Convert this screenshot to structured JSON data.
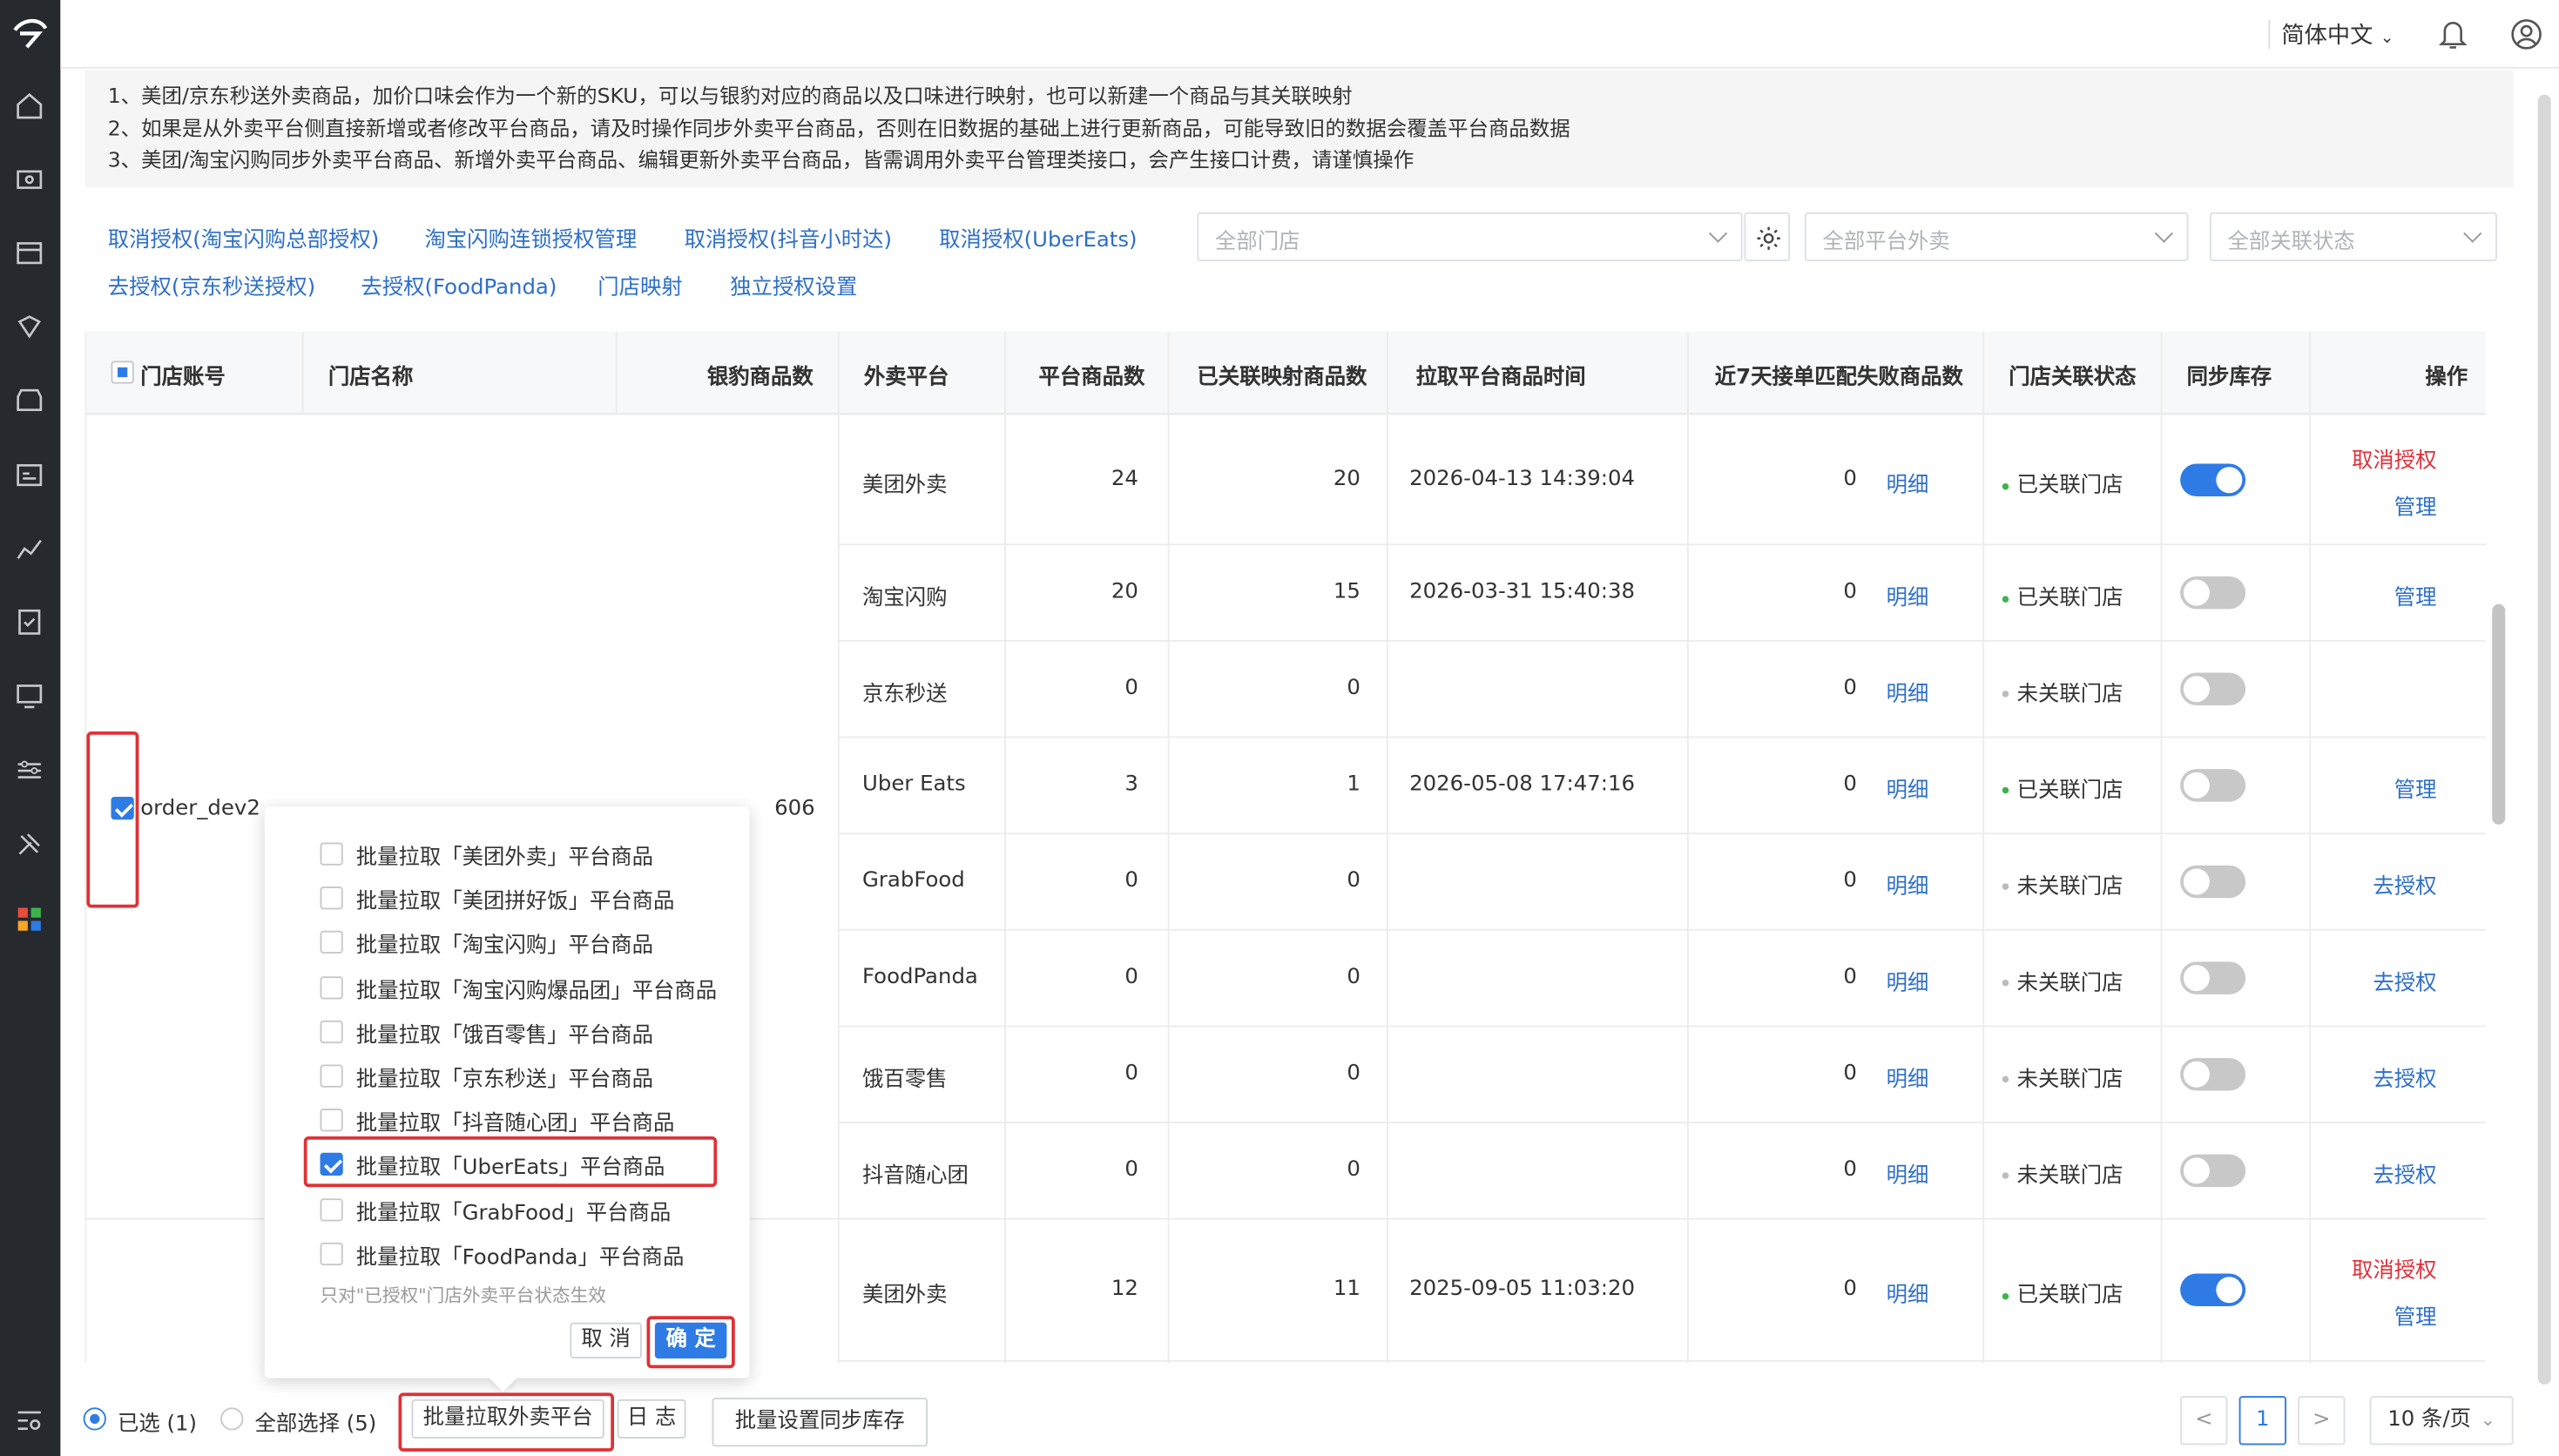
{
  "topbar": {
    "language": "简体中文"
  },
  "notice": [
    "1、美团/京东秒送外卖商品，加价口味会作为一个新的SKU，可以与银豹对应的商品以及口味进行映射，也可以新建一个商品与其关联映射",
    "2、如果是从外卖平台侧直接新增或者修改平台商品，请及时操作同步外卖平台商品，否则在旧数据的基础上进行更新商品，可能导致旧的数据会覆盖平台商品数据",
    "3、美团/淘宝闪购同步外卖平台商品、新增外卖平台商品、编辑更新外卖平台商品，皆需调用外卖平台管理类接口，会产生接口计费，请谨慎操作"
  ],
  "links": [
    "取消授权(淘宝闪购总部授权)",
    "淘宝闪购连锁授权管理",
    "取消授权(抖音小时达)",
    "取消授权(UberEats)",
    "去授权(京东秒送授权)",
    "去授权(FoodPanda)",
    "门店映射",
    "独立授权设置"
  ],
  "filters": {
    "store": "全部门店",
    "platform": "全部平台外卖",
    "status": "全部关联状态"
  },
  "columns": [
    "门店账号",
    "门店名称",
    "银豹商品数",
    "外卖平台",
    "平台商品数",
    "已关联映射商品数",
    "拉取平台商品时间",
    "近7天接单匹配失败商品数",
    "门店关联状态",
    "同步库存",
    "操作"
  ],
  "group1": {
    "account": "order_dev2",
    "name": "...",
    "product_count": "606"
  },
  "rows": [
    {
      "platform": "美团外卖",
      "platform_count": "24",
      "mapped": "20",
      "time": "2026-04-13 14:39:04",
      "fail": "0",
      "detail": "明细",
      "status": "已关联门店",
      "linked": true,
      "sync": true,
      "ops": [
        "取消授权",
        "管理"
      ]
    },
    {
      "platform": "淘宝闪购",
      "platform_count": "20",
      "mapped": "15",
      "time": "2026-03-31 15:40:38",
      "fail": "0",
      "detail": "明细",
      "status": "已关联门店",
      "linked": true,
      "sync": false,
      "ops": [
        "管理"
      ]
    },
    {
      "platform": "京东秒送",
      "platform_count": "0",
      "mapped": "0",
      "time": "",
      "fail": "0",
      "detail": "明细",
      "status": "未关联门店",
      "linked": false,
      "sync": false,
      "ops": []
    },
    {
      "platform": "Uber Eats",
      "platform_count": "3",
      "mapped": "1",
      "time": "2026-05-08 17:47:16",
      "fail": "0",
      "detail": "明细",
      "status": "已关联门店",
      "linked": true,
      "sync": false,
      "ops": [
        "管理"
      ]
    },
    {
      "platform": "GrabFood",
      "platform_count": "0",
      "mapped": "0",
      "time": "",
      "fail": "0",
      "detail": "明细",
      "status": "未关联门店",
      "linked": false,
      "sync": false,
      "ops": [
        "去授权"
      ]
    },
    {
      "platform": "FoodPanda",
      "platform_count": "0",
      "mapped": "0",
      "time": "",
      "fail": "0",
      "detail": "明细",
      "status": "未关联门店",
      "linked": false,
      "sync": false,
      "ops": [
        "去授权"
      ]
    },
    {
      "platform": "饿百零售",
      "platform_count": "0",
      "mapped": "0",
      "time": "",
      "fail": "0",
      "detail": "明细",
      "status": "未关联门店",
      "linked": false,
      "sync": false,
      "ops": [
        "去授权"
      ]
    },
    {
      "platform": "抖音随心团",
      "platform_count": "0",
      "mapped": "0",
      "time": "",
      "fail": "0",
      "detail": "明细",
      "status": "未关联门店",
      "linked": false,
      "sync": false,
      "ops": [
        "去授权"
      ]
    },
    {
      "platform": "美团外卖",
      "platform_count": "12",
      "mapped": "11",
      "time": "2025-09-05 11:03:20",
      "fail": "0",
      "detail": "明细",
      "status": "已关联门店",
      "linked": true,
      "sync": true,
      "ops": [
        "取消授权",
        "管理"
      ]
    }
  ],
  "popup": {
    "options": [
      {
        "label": "批量拉取「美团外卖」平台商品",
        "checked": false
      },
      {
        "label": "批量拉取「美团拼好饭」平台商品",
        "checked": false
      },
      {
        "label": "批量拉取「淘宝闪购」平台商品",
        "checked": false
      },
      {
        "label": "批量拉取「淘宝闪购爆品团」平台商品",
        "checked": false
      },
      {
        "label": "批量拉取「饿百零售」平台商品",
        "checked": false
      },
      {
        "label": "批量拉取「京东秒送」平台商品",
        "checked": false
      },
      {
        "label": "批量拉取「抖音随心团」平台商品",
        "checked": false
      },
      {
        "label": "批量拉取「UberEats」平台商品",
        "checked": true
      },
      {
        "label": "批量拉取「GrabFood」平台商品",
        "checked": false
      },
      {
        "label": "批量拉取「FoodPanda」平台商品",
        "checked": false
      }
    ],
    "hint": "只对\"已授权\"门店外卖平台状态生效",
    "cancel": "取 消",
    "ok": "确 定"
  },
  "bottom": {
    "selected_label": "已选 (1)",
    "all_label": "全部选择 (5)",
    "batch_pull": "批量拉取外卖平台",
    "log": "日 志",
    "batch_sync": "批量设置同步库存"
  },
  "pagination": {
    "prev": "<",
    "current": "1",
    "next": ">",
    "page_size": "10 条/页"
  },
  "colors": {
    "primary": "#2e7be6",
    "link": "#2d6fc9",
    "danger": "#e0303a",
    "linked_dot": "#3cb44b",
    "unlinked_dot": "#bbbbbb"
  }
}
